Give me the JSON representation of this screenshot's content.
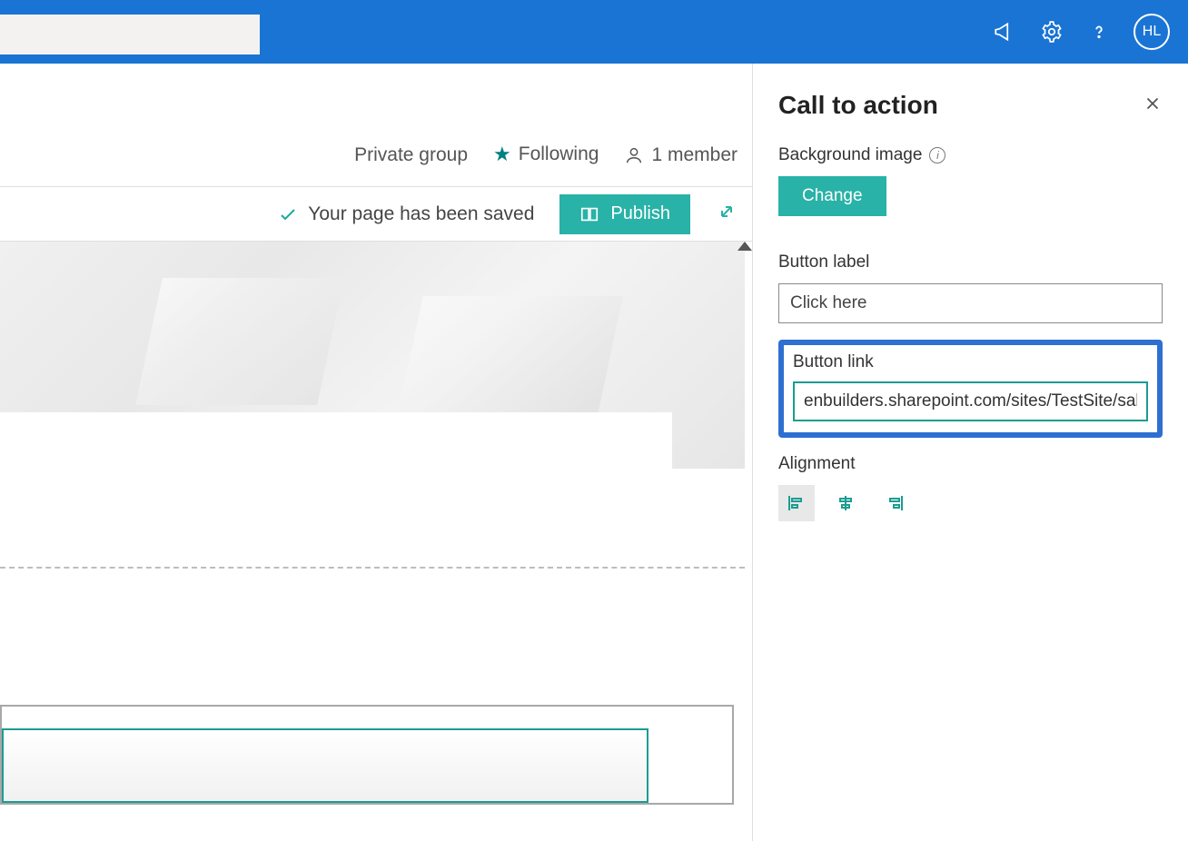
{
  "topbar": {
    "search_value": "",
    "avatar_initials": "HL"
  },
  "info": {
    "group_type": "Private group",
    "following_label": "Following",
    "members_label": "1 member"
  },
  "actions": {
    "saved_message": "Your page has been saved",
    "publish_label": "Publish"
  },
  "panel": {
    "title": "Call to action",
    "bg_label": "Background image",
    "change_label": "Change",
    "button_label_label": "Button label",
    "button_label_value": "Click here",
    "button_link_label": "Button link",
    "button_link_value": "enbuilders.sharepoint.com/sites/TestSite/sales",
    "alignment_label": "Alignment"
  }
}
